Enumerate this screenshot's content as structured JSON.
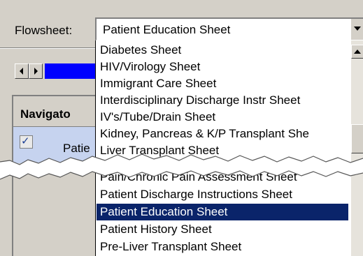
{
  "flowsheet": {
    "label": "Flowsheet:",
    "selected_value": "Patient Education Sheet"
  },
  "navigator": {
    "title": "Navigato",
    "row_label": "Patie",
    "row_checked": true
  },
  "dropdown": {
    "items": [
      {
        "label": "Diabetes Sheet"
      },
      {
        "label": "HIV/Virology Sheet"
      },
      {
        "label": "Immigrant Care Sheet"
      },
      {
        "label": "Interdisciplinary Discharge Instr Sheet"
      },
      {
        "label": "IV's/Tube/Drain Sheet"
      },
      {
        "label": "Kidney, Pancreas & K/P Transplant She"
      },
      {
        "label": "Liver Transplant Sheet"
      },
      {
        "label": "Pain/Chronic Pain Assessment Sheet"
      },
      {
        "label": "Patient Discharge Instructions Sheet"
      },
      {
        "label": "Patient Education Sheet",
        "selected": true
      },
      {
        "label": "Patient History Sheet"
      },
      {
        "label": "Pre-Liver Transplant Sheet"
      }
    ]
  },
  "colors": {
    "selection": "#0a246a",
    "blue_bar": "#0000ff",
    "nav_row_bg": "#c6d3ef"
  },
  "icons": {
    "combo_arrow": "chevron-down-icon",
    "scroll_left": "arrow-left-icon",
    "scroll_right": "arrow-right-icon",
    "scroll_up": "arrow-up-icon",
    "checkbox": "checkbox-checked-icon"
  }
}
